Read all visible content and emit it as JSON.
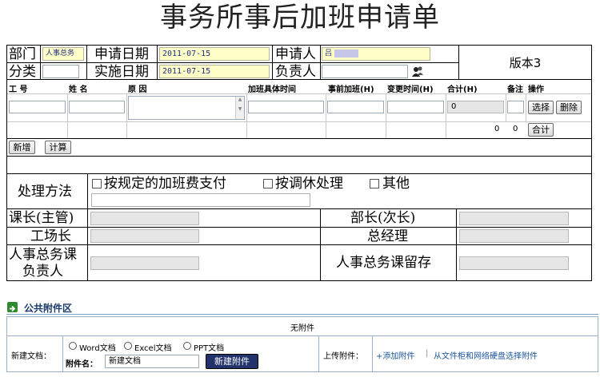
{
  "form_title": "事务所事后加班申请单",
  "header": {
    "dept_label": "部门",
    "dept_value": "人事总务",
    "apply_date_label": "申请日期",
    "apply_date_value": "2011-07-15",
    "applicant_label": "申请人",
    "applicant_value": "吕",
    "category_label": "分类",
    "category_value": "",
    "exec_date_label": "实施日期",
    "exec_date_value": "2011-07-15",
    "owner_label": "负责人",
    "owner_value": "",
    "version_label": "版本3"
  },
  "table": {
    "columns": [
      "工 号",
      "姓 名",
      "原 因",
      "加班具体时间",
      "事前加班(H)",
      "变更时间(H)",
      "合计(H)",
      "备注",
      "操作"
    ],
    "row_total": "0",
    "select_btn": "选择",
    "delete_btn": "删除",
    "sum_a": "0",
    "sum_b": "0",
    "sum_btn": "合计",
    "add_btn": "新增",
    "calc_btn": "计算"
  },
  "handling": {
    "label": "处理方法",
    "options": [
      "按规定的加班费支付",
      "按调休处理",
      "其他"
    ]
  },
  "approvals": {
    "section_chief": "课长(主管)",
    "dept_head": "部长(次长)",
    "factory_head": "工场长",
    "gm": "总经理",
    "hr_owner_line1": "人事总务课",
    "hr_owner_line2": "负责人",
    "hr_keep": "人事总务课留存"
  },
  "attachments": {
    "section_title": "公共附件区",
    "none_text": "无附件",
    "new_doc_label": "新建文档：",
    "doc_types": [
      "Word文档",
      "Excel文档",
      "PPT文档"
    ],
    "attach_name_label": "附件名：",
    "attach_name_value": "新建文档",
    "new_attach_btn": "新建附件",
    "upload_label": "上传附件：",
    "add_attach_link": "+添加附件",
    "separator": "|",
    "select_from_cabinet_link": "从文件柜和网络硬盘选择附件"
  }
}
